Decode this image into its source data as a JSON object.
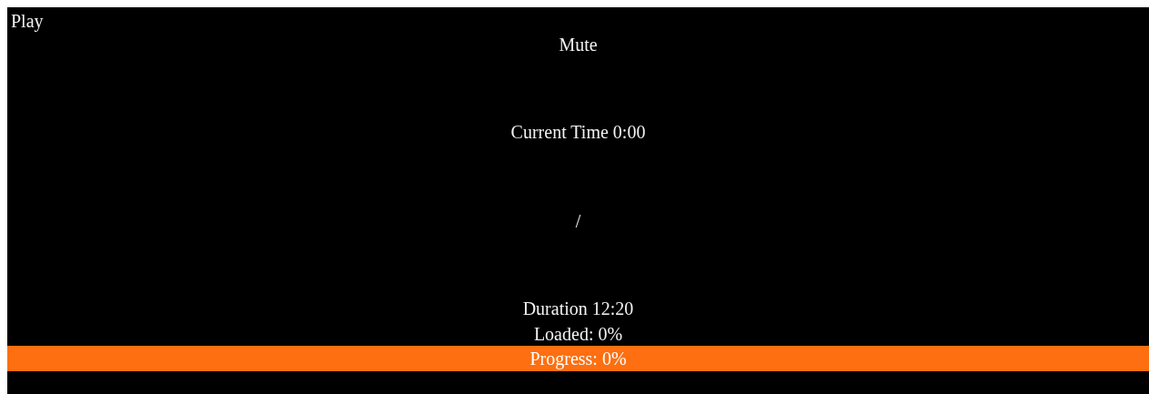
{
  "controls": {
    "play": "Play",
    "mute": "Mute",
    "current_time": "Current Time 0:00",
    "separator": "/",
    "duration": "Duration 12:20",
    "loaded": "Loaded: 0%",
    "progress": "Progress: 0%"
  }
}
